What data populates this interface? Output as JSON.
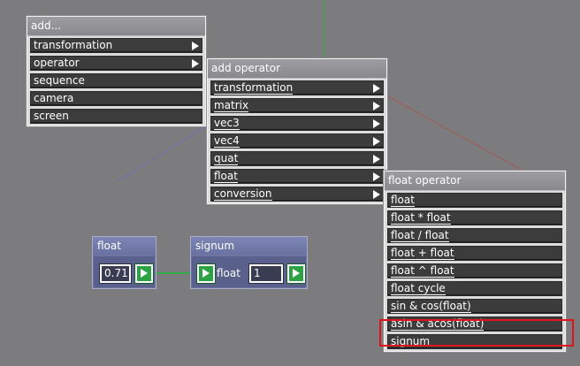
{
  "menus": {
    "add": {
      "title": "add...",
      "items": [
        {
          "label": "transformation",
          "submenu": true
        },
        {
          "label": "operator",
          "submenu": true
        },
        {
          "label": "sequence",
          "submenu": false
        },
        {
          "label": "camera",
          "submenu": false
        },
        {
          "label": "screen",
          "submenu": false
        }
      ]
    },
    "add_operator": {
      "title": "add operator",
      "items": [
        {
          "label": "transformation",
          "submenu": true
        },
        {
          "label": "matrix",
          "submenu": true
        },
        {
          "label": "vec3",
          "submenu": true
        },
        {
          "label": "vec4",
          "submenu": true
        },
        {
          "label": "quat",
          "submenu": true
        },
        {
          "label": "float",
          "submenu": true
        },
        {
          "label": "conversion",
          "submenu": true
        }
      ]
    },
    "float_operator": {
      "title": "float operator",
      "items": [
        {
          "label": "float"
        },
        {
          "label": "float * float"
        },
        {
          "label": "float / float"
        },
        {
          "label": "float + float"
        },
        {
          "label": "float ^ float"
        },
        {
          "label": "float cycle"
        },
        {
          "label": "sin & cos(float)"
        },
        {
          "label": "asin & acos(float)"
        },
        {
          "label": "signum"
        }
      ],
      "highlighted_item": "signum"
    }
  },
  "nodes": {
    "float_node": {
      "title": "float",
      "value": "0.71"
    },
    "signum_node": {
      "title": "signum",
      "input_label": "float",
      "value": "1"
    }
  },
  "colors": {
    "background": "#7c7c7e",
    "node_blue": "#6d74a2",
    "play_green": "#2da244",
    "highlight_red": "#e0141e",
    "connection_green": "#33aa44"
  }
}
